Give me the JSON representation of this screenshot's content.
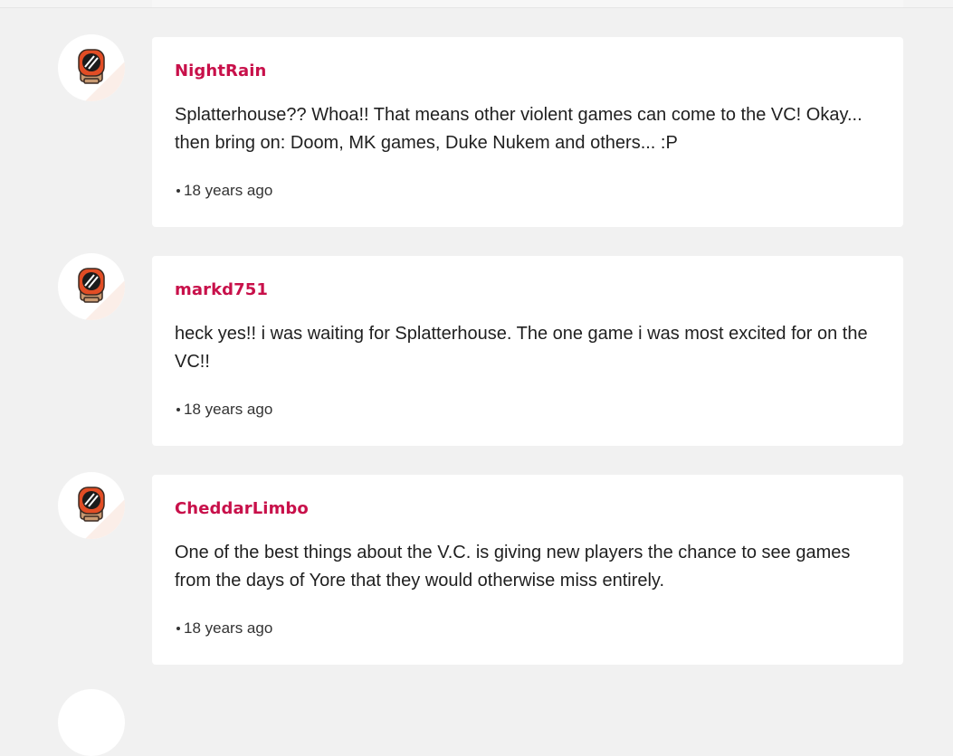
{
  "comments": [
    {
      "username": "NightRain",
      "text": "Splatterhouse?? Whoa!! That means other violent games can come to the VC! Okay... then bring on: Doom, MK games, Duke Nukem and others... :P",
      "timestamp": "18 years ago",
      "avatar_icon": "masked-face-avatar-icon"
    },
    {
      "username": "markd751",
      "text": "heck yes!! i was waiting for Splatterhouse. The one game i was most excited for on the VC!!",
      "timestamp": "18 years ago",
      "avatar_icon": "masked-face-avatar-icon"
    },
    {
      "username": "CheddarLimbo",
      "text": "One of the best things about the V.C. is giving new players the chance to see games from the days of Yore that they would otherwise miss entirely.",
      "timestamp": "18 years ago",
      "avatar_icon": "masked-face-avatar-icon"
    }
  ],
  "colors": {
    "username": "#c8104a",
    "background": "#f1f1f1",
    "card": "#ffffff",
    "text": "#1f1f1f"
  }
}
